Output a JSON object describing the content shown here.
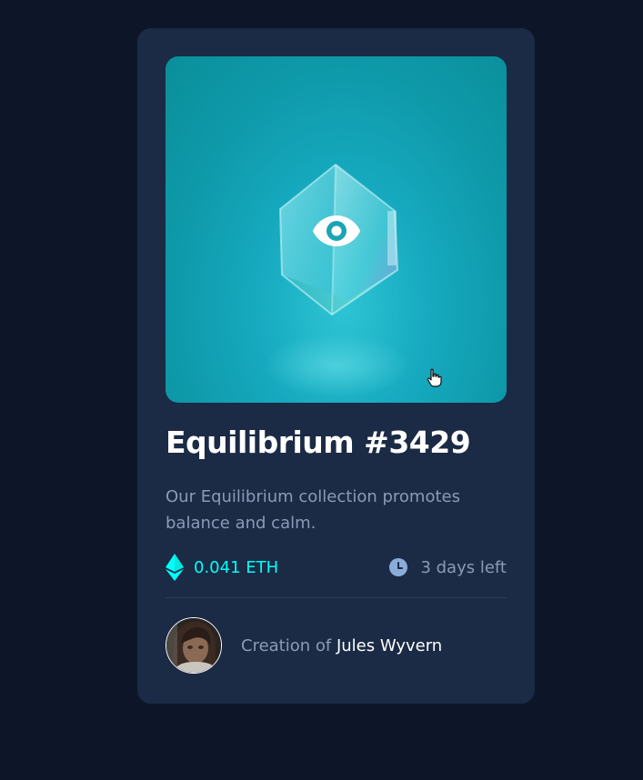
{
  "card": {
    "title": "Equilibrium #3429",
    "description": "Our Equilibrium collection promotes balance and calm.",
    "price": "0.041 ETH",
    "time_left": "3 days left",
    "creator_prefix": "Creation of ",
    "creator_name": "Jules Wyvern"
  },
  "icons": {
    "view": "eye-icon",
    "price": "ethereum-icon",
    "time": "clock-icon",
    "cursor": "hand-pointer-icon"
  },
  "colors": {
    "background": "#0d1628",
    "card": "#1b2a45",
    "accent": "#00fff8",
    "muted_text": "#8a9bb8",
    "title_text": "#ffffff",
    "divider": "#2e3d5c"
  }
}
